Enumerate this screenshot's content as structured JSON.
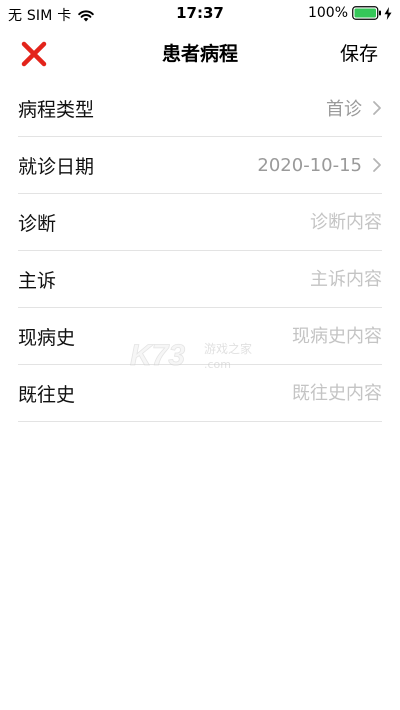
{
  "status_bar": {
    "carrier": "无 SIM 卡",
    "time": "17:37",
    "battery": "100%"
  },
  "nav": {
    "title": "患者病程",
    "save_label": "保存",
    "close_icon_color": "#e3241b"
  },
  "rows": [
    {
      "label": "病程类型",
      "value": "首诊"
    },
    {
      "label": "就诊日期",
      "value": "2020-10-15"
    },
    {
      "label": "诊断",
      "placeholder": "诊断内容"
    },
    {
      "label": "主诉",
      "placeholder": "主诉内容"
    },
    {
      "label": "现病史",
      "placeholder": "现病史内容"
    },
    {
      "label": "既往史",
      "placeholder": "既往史内容"
    }
  ],
  "watermark": {
    "logo_text": "K73",
    "text": "游戏之家",
    "domain": ".com"
  }
}
